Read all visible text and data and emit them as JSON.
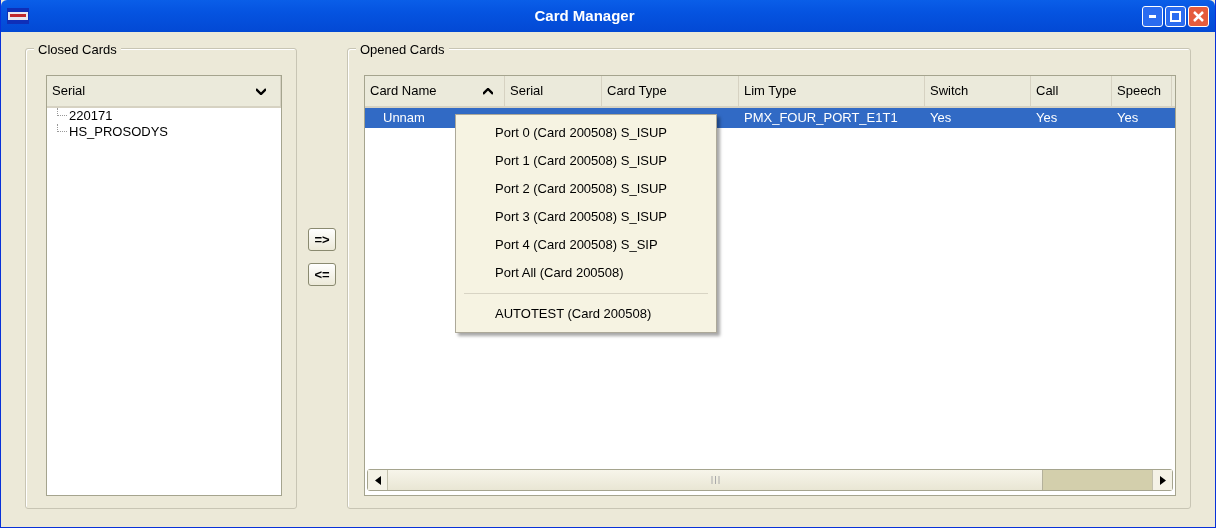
{
  "window": {
    "title": "Card Manager"
  },
  "closed_cards": {
    "title": "Closed Cards",
    "column": {
      "label": "Serial",
      "sorted": true,
      "descending": true
    },
    "items": [
      {
        "label": "220171",
        "selected": false
      },
      {
        "label": "HS_PROSODYS",
        "selected": false
      }
    ]
  },
  "transfer_buttons": [
    "=>",
    "<="
  ],
  "opened_cards": {
    "title": "Opened Cards",
    "columns": [
      {
        "label": "Card Name",
        "sorted": true,
        "descending": false
      },
      {
        "label": "Serial",
        "sorted": false
      },
      {
        "label": "Card Type",
        "sorted": false
      },
      {
        "label": "Lim Type",
        "sorted": false
      },
      {
        "label": "Switch",
        "sorted": false
      },
      {
        "label": "Call",
        "sorted": false
      },
      {
        "label": "Speech",
        "sorted": false
      }
    ],
    "rows": [
      {
        "selected": true,
        "cells": [
          "Unnam",
          "",
          "",
          "PMX_FOUR_PORT_E1T1",
          "Yes",
          "Yes",
          "Yes"
        ]
      }
    ]
  },
  "context_menu": [
    {
      "kind": "item",
      "label": "Port 0 (Card 200508) S_ISUP"
    },
    {
      "kind": "item",
      "label": "Port 1 (Card 200508) S_ISUP"
    },
    {
      "kind": "item",
      "label": "Port 2 (Card 200508) S_ISUP"
    },
    {
      "kind": "item",
      "label": "Port 3 (Card 200508) S_ISUP"
    },
    {
      "kind": "item",
      "label": "Port 4 (Card 200508) S_SIP"
    },
    {
      "kind": "item",
      "label": "Port All (Card 200508)"
    },
    {
      "kind": "separator"
    },
    {
      "kind": "item",
      "label": "AUTOTEST (Card 200508)"
    }
  ]
}
